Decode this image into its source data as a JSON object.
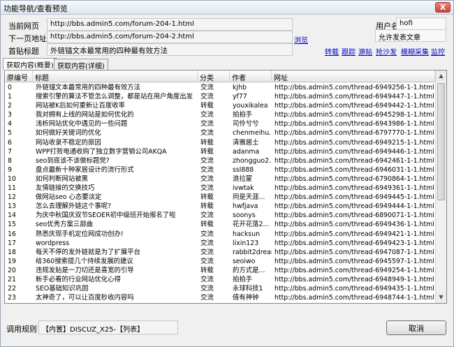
{
  "window": {
    "title": "功能导航/查看预览",
    "close_label": "X"
  },
  "form": {
    "current_page_label": "当前网页",
    "current_page_value": "http://bbs.admin5.com/forum-204-1.html",
    "next_page_label": "下一页地址",
    "next_page_value": "http://bbs.admin5.com/forum-204-2.html",
    "first_post_title_label": "首贴标题",
    "first_post_title_value": "外链锚文本最常用的四种最有效方法",
    "browse_link": "浏览",
    "username_label": "用户名",
    "username_value": "hofi",
    "permission_text": "允许发表文章"
  },
  "actions": [
    "转载",
    "跟踪",
    "源贴",
    "抢沙发",
    "模糊采集",
    "监控"
  ],
  "tabs": [
    "获取内容(概要)",
    "获取内容(详细)"
  ],
  "grid": {
    "columns": [
      "原编号",
      "标题",
      "分类",
      "作者",
      "网址"
    ],
    "rows": [
      [
        "0",
        "外链锚文本最常用的四种最有效方法",
        "交流",
        "kjhb",
        "http://bbs.admin5.com/thread-6949256-1-1.html"
      ],
      [
        "1",
        "搜索引擎的算法不管怎么调整，都是站在用户角度出发",
        "交流",
        "yf77",
        "http://bbs.admin5.com/thread-6949447-1-1.html"
      ],
      [
        "2",
        "网站被K后如何重新让百度收率",
        "转载",
        "youxikalea",
        "http://bbs.admin5.com/thread-6949442-1-1.html"
      ],
      [
        "3",
        "我对拥有上线的网站是如何优化的",
        "交流",
        "拍拍手",
        "http://bbs.admin5.com/thread-6945298-1-1.html"
      ],
      [
        "4",
        "浅析网站优化中遇见的一些问题",
        "交流",
        "司伶兮兮",
        "http://bbs.admin5.com/thread-6943986-1-1.html"
      ],
      [
        "5",
        "如何做好关键词的优化",
        "交流",
        "chenmeihu...",
        "http://bbs.admin5.com/thread-6797770-1-1.html"
      ],
      [
        "6",
        "网站收录不稳定的原因",
        "转载",
        "清雅居士",
        "http://bbs.admin5.com/thread-6949215-1-1.html"
      ],
      [
        "7",
        "WPP打败电通收购了独立数字营销公司AKQA",
        "转载",
        "adanma",
        "http://bbs.admin5.com/thread-6949446-1-1.html"
      ],
      [
        "8",
        "seo到底该不该做标题党?",
        "交流",
        "zhongguo2...",
        "http://bbs.admin5.com/thread-6942461-1-1.html"
      ],
      [
        "9",
        "盘点最新十种家居设计的流行形式",
        "交流",
        "ssl888",
        "http://bbs.admin5.com/thread-6946031-1-1.html"
      ],
      [
        "10",
        "如何判断网站被黑",
        "交流",
        "浪拉蒙",
        "http://bbs.admin5.com/thread-6790864-1-1.html"
      ],
      [
        "11",
        "友情链接的交换技巧",
        "交流",
        "ivwtak",
        "http://bbs.admin5.com/thread-6949361-1-1.html"
      ],
      [
        "12",
        "做网站seo 心态要淡定",
        "转载",
        "同是天涯...",
        "http://bbs.admin5.com/thread-6949445-1-1.html"
      ],
      [
        "13",
        "怎么去理解外链这个事呢?",
        "转载",
        "hwfjava",
        "http://bbs.admin5.com/thread-6949444-1-1.html"
      ],
      [
        "14",
        "为庆中秋国庆双节SEOER初中级班开始报名了啦",
        "交流",
        "soonys",
        "http://bbs.admin5.com/thread-6890071-1-1.html"
      ],
      [
        "15",
        "seo优秀方案三部曲",
        "转载",
        "花开花落2...",
        "http://bbs.admin5.com/thread-6949436-1-1.html"
      ],
      [
        "16",
        "熟悉庆现手机定位网成功创办!",
        "交流",
        "hacksun",
        "http://bbs.admin5.com/thread-6949421-1-1.html"
      ],
      [
        "17",
        "wordpress",
        "交流",
        "lixin123",
        "http://bbs.admin5.com/thread-6949423-1-1.html"
      ],
      [
        "18",
        "每天不停的发外链就是为了扩展平台",
        "交流",
        "rabbit2dream",
        "http://bbs.admin5.com/thread-6947087-1-1.html"
      ],
      [
        "19",
        "给360搜索提几个持续发展的建议",
        "交流",
        "seoiwo",
        "http://bbs.admin5.com/thread-6945597-1-1.html"
      ],
      [
        "20",
        "违规发贴是一刀切还是喜宽的引导",
        "转载",
        "的方式是...",
        "http://bbs.admin5.com/thread-6949254-1-1.html"
      ],
      [
        "21",
        "新手必看的行业网站优化心得",
        "交流",
        "拍拍手",
        "http://bbs.admin5.com/thread-6948949-1-1.html"
      ],
      [
        "22",
        "SEO基础知识巩固",
        "交流",
        "永球科技1",
        "http://bbs.admin5.com/thread-6949435-1-1.html"
      ],
      [
        "23",
        "太神奇了，可以让百度秒收内容吗",
        "交流",
        "倩有神钟",
        "http://bbs.admin5.com/thread-6948744-1-1.html"
      ]
    ]
  },
  "footer": {
    "rule_label": "调用规则",
    "rule_value": "【内置】DISCUZ_X25-【列表】",
    "cancel_label": "取消"
  },
  "colors": {
    "link": "#0000cc",
    "titlebar": "#dfe6f0",
    "grid_bg": "#ffffff"
  }
}
